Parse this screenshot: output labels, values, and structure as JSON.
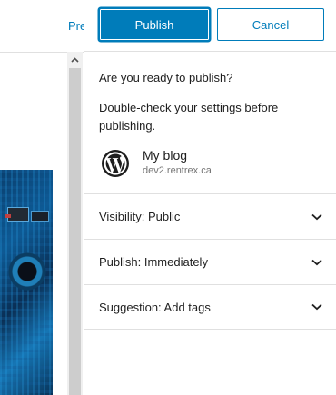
{
  "editor": {
    "preview_label": "Pre"
  },
  "publish_panel": {
    "publish_button": "Publish",
    "cancel_button": "Cancel",
    "heading": "Are you ready to publish?",
    "description": "Double-check your settings before publishing.",
    "site": {
      "name": "My blog",
      "url": "dev2.rentrex.ca",
      "icon": "wordpress-icon"
    },
    "rows": [
      {
        "label": "Visibility: Public"
      },
      {
        "label": "Publish: Immediately"
      },
      {
        "label": "Suggestion: Add tags"
      }
    ]
  },
  "colors": {
    "accent": "#007cba",
    "muted_text": "#757575",
    "divider": "#e0e0e0"
  }
}
